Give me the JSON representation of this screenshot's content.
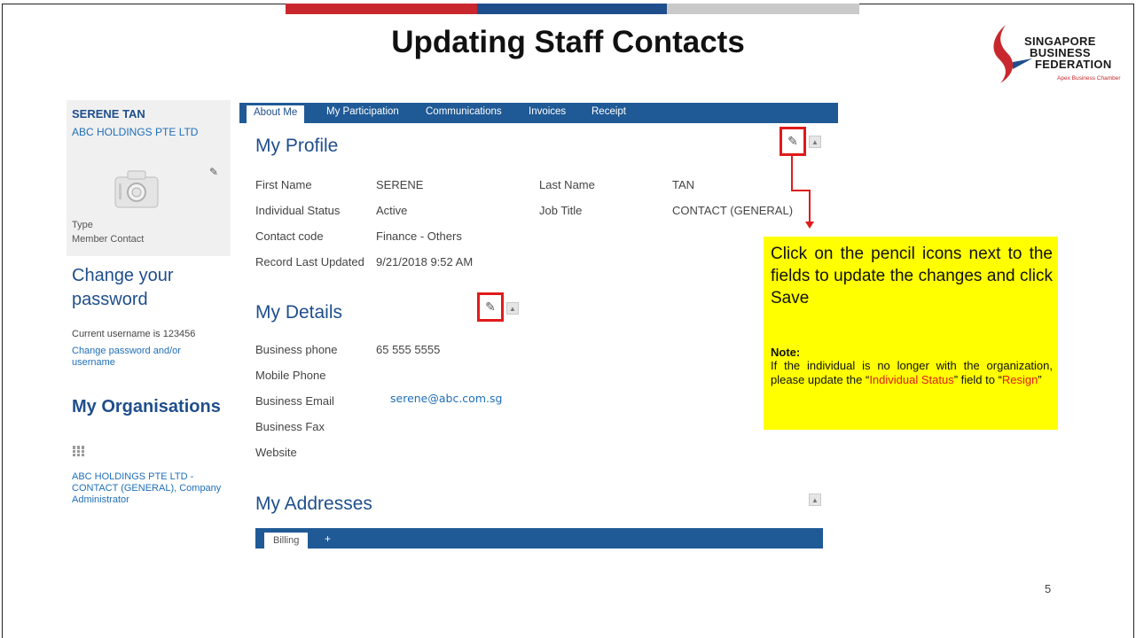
{
  "slide": {
    "title": "Updating Staff Contacts",
    "page_number": "5"
  },
  "logo": {
    "line1": "SINGAPORE",
    "line2": "BUSINESS",
    "line3": "FEDERATION",
    "tagline": "Apex Business Chamber"
  },
  "profile_sidebar": {
    "name": "SERENE TAN",
    "organisation": "ABC HOLDINGS PTE LTD",
    "type_label": "Type",
    "type_value": "Member Contact",
    "change_password_heading": "Change your password",
    "username_line": "Current username is  123456",
    "change_link": "Change password and/or username",
    "my_organisations_heading": "My Organisations",
    "org_entry": "ABC HOLDINGS PTE LTD  -  CONTACT (GENERAL), Company Administrator"
  },
  "tabs": [
    {
      "label": "About Me",
      "active": true
    },
    {
      "label": "My Participation",
      "active": false
    },
    {
      "label": "Communications",
      "active": false
    },
    {
      "label": "Invoices",
      "active": false
    },
    {
      "label": "Receipt",
      "active": false
    }
  ],
  "my_profile": {
    "title": "My Profile",
    "fields": {
      "first_name_label": "First Name",
      "first_name_value": "SERENE",
      "last_name_label": "Last Name",
      "last_name_value": "TAN",
      "status_label": "Individual Status",
      "status_value": "Active",
      "job_title_label": "Job Title",
      "job_title_value": "CONTACT (GENERAL)",
      "contact_code_label": "Contact code",
      "contact_code_value": "Finance - Others",
      "updated_label": "Record Last Updated",
      "updated_value": "9/21/2018 9:52 AM"
    }
  },
  "my_details": {
    "title": "My Details",
    "fields": {
      "business_phone_label": "Business phone",
      "business_phone_value": "65 555 5555",
      "mobile_label": "Mobile Phone",
      "email_label": "Business Email",
      "email_value": "serene@abc.com.sg",
      "fax_label": "Business Fax",
      "website_label": "Website"
    }
  },
  "my_addresses": {
    "title": "My Addresses",
    "billing_tab": "Billing",
    "add_tab": "+"
  },
  "callout": {
    "main": "Click on the pencil icons next to the fields to update the changes and click Save",
    "note_label": "Note:",
    "note_part1": "If the individual is no longer with the organization, please update the “",
    "note_highlight1": "Individual Status",
    "note_part2": "” field to “",
    "note_highlight2": "Resign",
    "note_part3": "”"
  },
  "colors": {
    "brand_blue": "#1f5a96",
    "highlight_red": "#e01b1b",
    "callout_yellow": "#ffff00"
  }
}
